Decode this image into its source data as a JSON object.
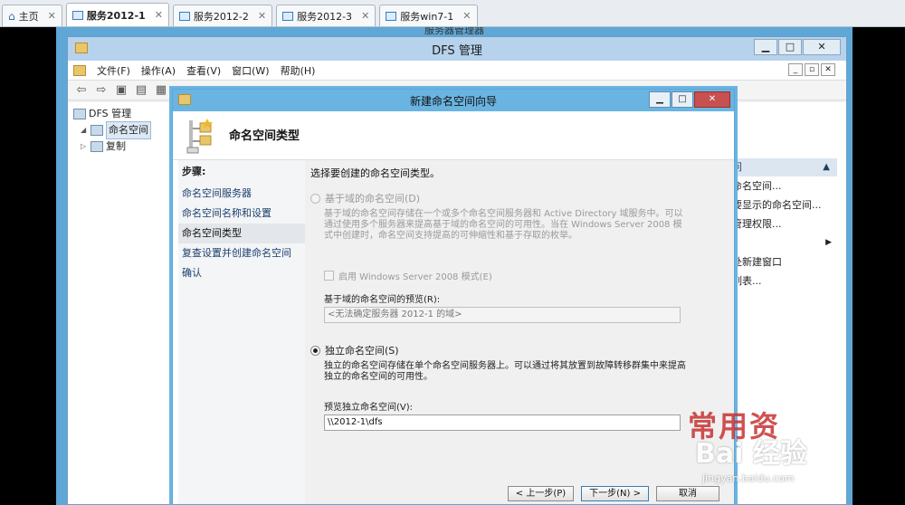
{
  "host_tabs": [
    {
      "label": "主页",
      "active": false
    },
    {
      "label": "服务2012-1",
      "active": true
    },
    {
      "label": "服务2012-2",
      "active": false
    },
    {
      "label": "服务2012-3",
      "active": false
    },
    {
      "label": "服务win7-1",
      "active": false
    }
  ],
  "background_title": "服务器管理器",
  "dfs": {
    "title": "DFS 管理",
    "menu": [
      "文件(F)",
      "操作(A)",
      "查看(V)",
      "窗口(W)",
      "帮助(H)"
    ],
    "tree": {
      "root": "DFS 管理",
      "items": [
        "命名空间",
        "复制"
      ]
    },
    "actions_header": "问",
    "actions": [
      "命名空间...",
      "要显示的命名空间...",
      "管理权限...",
      "处新建窗口",
      "列表..."
    ]
  },
  "wizard": {
    "title": "新建命名空间向导",
    "header_title": "命名空间类型",
    "steps_heading": "步骤:",
    "steps": [
      "命名空间服务器",
      "命名空间名称和设置",
      "命名空间类型",
      "复查设置并创建命名空间",
      "确认"
    ],
    "current_step": 2,
    "prompt": "选择要创建的命名空间类型。",
    "domain_option": {
      "label": "基于域的命名空间(D)",
      "description": "基于域的命名空间存储在一个或多个命名空间服务器和 Active Directory 域服务中。可以通过使用多个服务器来提高基于域的命名空间的可用性。当在 Windows Server 2008 模式中创建时，命名空间支持提高的可伸缩性和基于存取的枚举。",
      "checkbox_label": "启用 Windows Server 2008 模式(E)",
      "preview_label": "基于域的命名空间的预览(R):",
      "preview_value": "<无法确定服务器 2012-1 的域>"
    },
    "standalone_option": {
      "label": "独立命名空间(S)",
      "description": "独立的命名空间存储在单个命名空间服务器上。可以通过将其放置到故障转移群集中来提高独立的命名空间的可用性。",
      "preview_label": "预览独立命名空间(V):",
      "preview_value": "\\\\2012-1\\dfs"
    },
    "buttons": {
      "back": "< 上一步(P)",
      "next": "下一步(N) >",
      "cancel": "取消"
    }
  },
  "watermark": {
    "line1": "常用资",
    "line2": "Bai 经验",
    "url": "jingyan.baidu.com"
  }
}
